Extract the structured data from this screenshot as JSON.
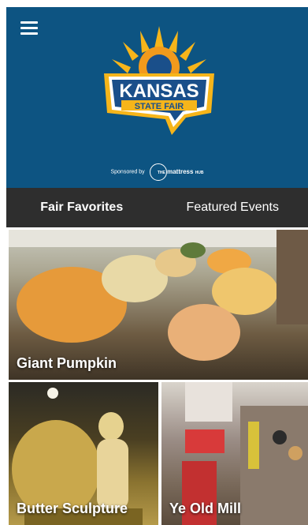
{
  "header": {
    "menu_icon": "hamburger-menu-icon",
    "logo": {
      "line1": "KANSAS",
      "line2": "STATE FAIR"
    },
    "sponsor": {
      "prefix": "Sponsored by",
      "brand_small": "THE",
      "brand_name": "mattress",
      "brand_sub": "HUB"
    }
  },
  "tabs": [
    {
      "label": "Fair Favorites",
      "active": true
    },
    {
      "label": "Featured Events",
      "active": false
    }
  ],
  "tiles": [
    {
      "title": "Giant Pumpkin"
    },
    {
      "title": "Butter Sculpture"
    },
    {
      "title": "Ye Old Mill"
    }
  ],
  "colors": {
    "header_bg": "#0d5482",
    "tab_bar_bg": "#2e2e2e",
    "logo_gold": "#f6b51a",
    "logo_blue": "#1a4f8a"
  }
}
